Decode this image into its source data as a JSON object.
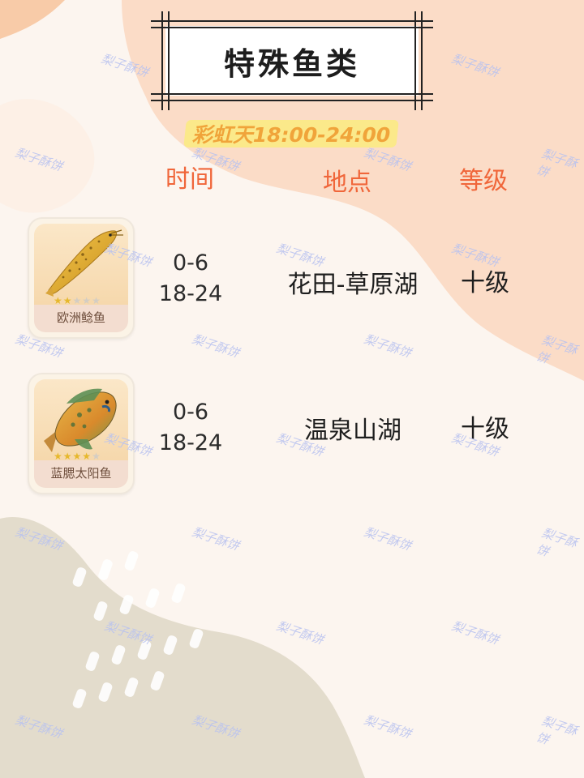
{
  "title": "特殊鱼类",
  "subtitle": "彩虹天18:00-24:00",
  "headers": {
    "time": "时间",
    "place": "地点",
    "level": "等级"
  },
  "fish": [
    {
      "name": "欧洲鲶鱼",
      "stars": 2,
      "max_stars": 5,
      "time_1": "0-6",
      "time_2": "18-24",
      "location": "花田-草原湖",
      "level": "十级"
    },
    {
      "name": "蓝腮太阳鱼",
      "stars": 4,
      "max_stars": 5,
      "time_1": "0-6",
      "time_2": "18-24",
      "location": "温泉山湖",
      "level": "十级"
    }
  ],
  "watermark": "梨子酥饼",
  "colors": {
    "header": "#f0663a",
    "subtitle_text": "#f0a43a",
    "subtitle_bg": "#fbe98a",
    "peach_shape": "#fbdcc7",
    "sage_shape": "#e3dccc",
    "page_bg": "#fcf5ef"
  }
}
